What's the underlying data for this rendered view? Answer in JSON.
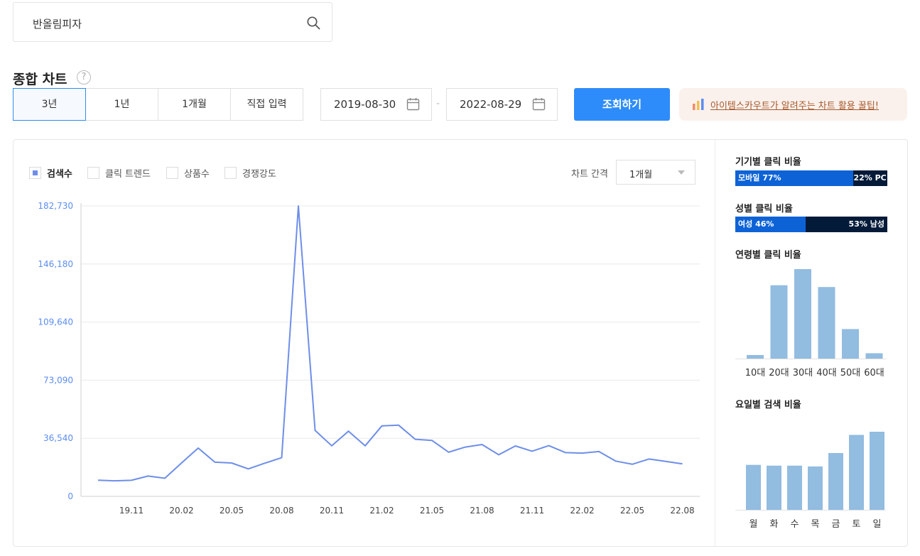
{
  "search": {
    "value": "반올림피자"
  },
  "section": {
    "title": "종합 차트",
    "help": "?"
  },
  "period_tabs": [
    {
      "label": "3년",
      "active": true
    },
    {
      "label": "1년",
      "active": false
    },
    {
      "label": "1개월",
      "active": false
    },
    {
      "label": "직접 입력",
      "active": false
    }
  ],
  "date_range": {
    "start": "2019-08-30",
    "end": "2022-08-29",
    "separator": "-"
  },
  "query_button": {
    "label": "조회하기"
  },
  "tip": {
    "text": "아이템스카우트가 알려주는 차트 활용 꿀팁!"
  },
  "legend": [
    {
      "label": "검색수",
      "checked": true
    },
    {
      "label": "클릭 트렌드",
      "checked": false
    },
    {
      "label": "상품수",
      "checked": false
    },
    {
      "label": "경쟁강도",
      "checked": false
    }
  ],
  "interval": {
    "label": "차트 간격",
    "value": "1개월"
  },
  "chart_data": [
    {
      "type": "line",
      "title": "",
      "xlabel": "",
      "ylabel": "",
      "y_ticks": [
        "0",
        "36,540",
        "73,090",
        "109,640",
        "146,180",
        "182,730"
      ],
      "ylim": [
        0,
        182730
      ],
      "x_ticks": [
        "19.11",
        "20.02",
        "20.05",
        "20.08",
        "20.11",
        "21.02",
        "21.05",
        "21.08",
        "21.11",
        "22.02",
        "22.05",
        "22.08"
      ],
      "grid": true,
      "color": "#6e8ee8",
      "series": [
        {
          "x": [
            "19.09",
            "19.10",
            "19.11",
            "19.12",
            "20.01",
            "20.02",
            "20.03",
            "20.04",
            "20.05",
            "20.06",
            "20.07",
            "20.08",
            "20.09",
            "20.10",
            "20.11",
            "20.12",
            "21.01",
            "21.02",
            "21.03",
            "21.04",
            "21.05",
            "21.06",
            "21.07",
            "21.08",
            "21.09",
            "21.10",
            "21.11",
            "21.12",
            "22.01",
            "22.02",
            "22.03",
            "22.04",
            "22.05",
            "22.06",
            "22.07",
            "22.08"
          ],
          "values": [
            10200,
            9800,
            10100,
            12800,
            11400,
            21000,
            30400,
            21500,
            21000,
            17300,
            20900,
            24300,
            182700,
            41500,
            31800,
            41000,
            31800,
            44300,
            44800,
            35900,
            35200,
            27800,
            31000,
            32600,
            26200,
            31700,
            28400,
            31900,
            27500,
            27200,
            28200,
            22200,
            20200,
            23500,
            22000,
            20400
          ]
        }
      ]
    },
    {
      "type": "bar",
      "title": "기기별 클릭 비율",
      "series": [
        {
          "name": "모바일",
          "value": 77,
          "label": "77%",
          "color": "#0d63d6"
        },
        {
          "name": "PC",
          "value": 22,
          "label": "22%",
          "color": "#031a38"
        }
      ]
    },
    {
      "type": "bar",
      "title": "성별 클릭 비율",
      "series": [
        {
          "name": "여성",
          "value": 46,
          "label": "46%",
          "color": "#0d63d6"
        },
        {
          "name": "남성",
          "value": 53,
          "label": "53%",
          "color": "#031a38"
        }
      ]
    },
    {
      "type": "bar",
      "title": "연령별 클릭 비율",
      "categories": [
        "10대",
        "20대",
        "30대",
        "40대",
        "50대",
        "60대"
      ],
      "values": [
        4,
        82,
        100,
        80,
        33,
        6
      ],
      "color": "#92bce0"
    },
    {
      "type": "bar",
      "title": "요일별 검색 비율",
      "categories": [
        "월",
        "화",
        "수",
        "목",
        "금",
        "토",
        "일"
      ],
      "values": [
        57,
        56,
        56,
        55,
        72,
        95,
        99
      ],
      "color": "#92bce0"
    }
  ]
}
